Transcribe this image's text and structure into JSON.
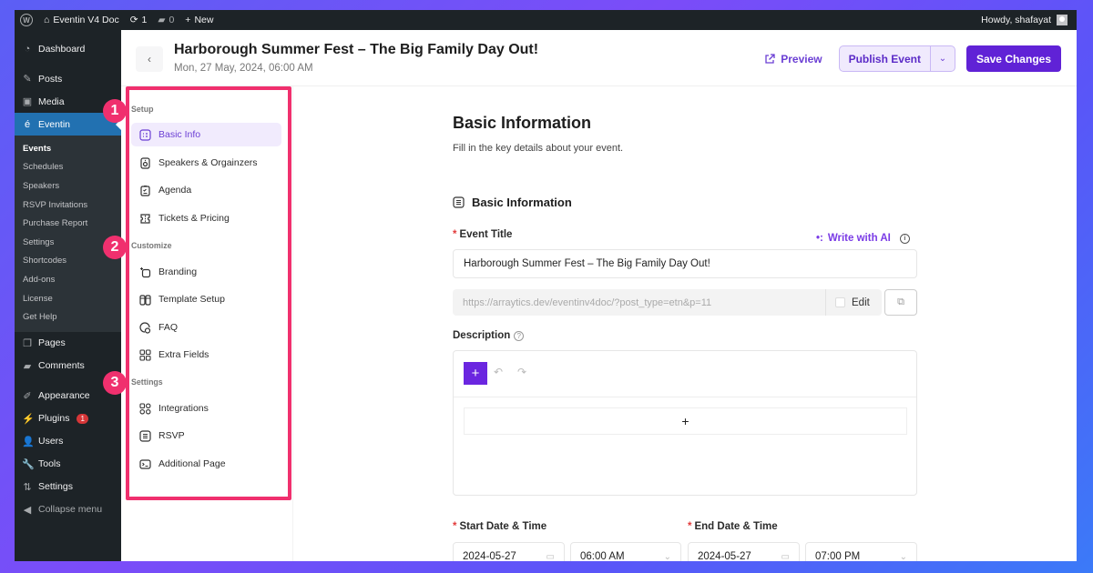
{
  "adminbar": {
    "site_name": "Eventin V4 Doc",
    "updates_count": "1",
    "comments_count": "0",
    "new_label": "New",
    "howdy": "Howdy, shafayat"
  },
  "wp_menu": {
    "items_top": [
      {
        "label": "Dashboard",
        "icon": "dashboard-icon"
      },
      {
        "label": "Posts",
        "icon": "pin-icon"
      },
      {
        "label": "Media",
        "icon": "media-icon"
      },
      {
        "label": "Eventin",
        "icon": "eventin-icon"
      }
    ],
    "eventin_sub": [
      "Events",
      "Schedules",
      "Speakers",
      "RSVP Invitations",
      "Purchase Report",
      "Settings",
      "Shortcodes",
      "Add-ons",
      "License",
      "Get Help"
    ],
    "items_bottom": [
      {
        "label": "Pages",
        "icon": "pages-icon"
      },
      {
        "label": "Comments",
        "icon": "comments-icon"
      },
      {
        "label": "Appearance",
        "icon": "appearance-icon"
      },
      {
        "label": "Plugins",
        "icon": "plugins-icon",
        "badge": "1"
      },
      {
        "label": "Users",
        "icon": "users-icon"
      },
      {
        "label": "Tools",
        "icon": "tools-icon"
      },
      {
        "label": "Settings",
        "icon": "settings-icon"
      }
    ],
    "collapse_label": "Collapse menu"
  },
  "header": {
    "event_title": "Harborough Summer Fest – The Big Family Day Out!",
    "event_date": "Mon, 27 May, 2024, 06:00 AM",
    "preview_label": "Preview",
    "publish_label": "Publish Event",
    "save_label": "Save Changes"
  },
  "event_nav": {
    "sections": [
      {
        "title": "Setup",
        "badge": "1",
        "items": [
          "Basic Info",
          "Speakers & Orgainzers",
          "Agenda",
          "Tickets & Pricing"
        ]
      },
      {
        "title": "Customize",
        "badge": "2",
        "items": [
          "Branding",
          "Template Setup",
          "FAQ",
          "Extra Fields"
        ]
      },
      {
        "title": "Settings",
        "badge": "3",
        "items": [
          "Integrations",
          "RSVP",
          "Additional Page"
        ]
      }
    ],
    "active_item": "Basic Info"
  },
  "form": {
    "page_title": "Basic Information",
    "page_subtitle": "Fill in the key details about your event.",
    "section_title": "Basic Information",
    "event_title_label": "Event Title",
    "write_ai_label": "Write with AI",
    "event_title_value": "Harborough Summer Fest – The Big Family Day Out!",
    "permalink": "https://arraytics.dev/eventinv4doc/?post_type=etn&p=11",
    "edit_label": "Edit",
    "description_label": "Description",
    "start_label": "Start Date & Time",
    "end_label": "End Date & Time",
    "start_date": "2024-05-27",
    "start_time": "06:00 AM",
    "end_date": "2024-05-27",
    "end_time": "07:00 PM"
  },
  "colors": {
    "accent": "#6022d6",
    "highlight": "#f0306e",
    "wp_active": "#2271b1"
  }
}
